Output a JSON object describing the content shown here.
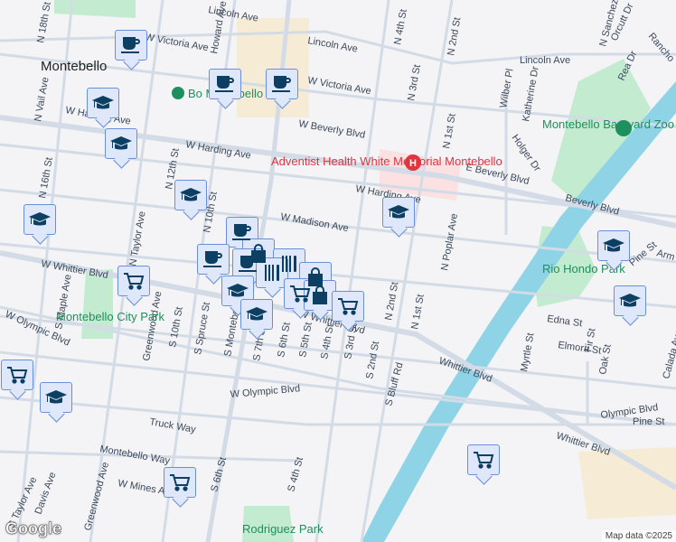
{
  "map": {
    "city_label": "Montebello",
    "streets": [
      "Lincoln Ave",
      "Lincoln Ave",
      "Lincoln Ave",
      "W Victoria Ave",
      "W Victoria Ave",
      "W Beverly Blvd",
      "E Beverly Blvd",
      "Beverly Blvd",
      "W Harding Ave",
      "W Harding Ave",
      "W Harding Ave",
      "W Madison Ave",
      "W Whittier Blvd",
      "W Whittier Blvd",
      "Whittier Blvd",
      "Whittier Blvd",
      "W Olympic Blvd",
      "W Olympic Blvd",
      "Olympic Blvd",
      "Truck Way",
      "Montebello Way",
      "W Mines Ave",
      "N 18th St",
      "N 16th St",
      "N Vail Ave",
      "N 12th St",
      "N 10th St",
      "Howard Ave",
      "N 4th St",
      "N 3rd St",
      "N 2nd St",
      "N 1st St",
      "N Poplar Ave",
      "Wilber Pl",
      "Katherine Dr",
      "Holger Dr",
      "N Sanchez",
      "Orcutt Dr",
      "Rancho",
      "Rea Dr",
      "N Taylor Ave",
      "S Maple Ave",
      "Greenwood Ave",
      "S 10th St",
      "S Spruce St",
      "S Montebello Blvd",
      "S 7th St",
      "S 6th St",
      "S 5th St",
      "S 4th St",
      "S 3rd St",
      "S 2nd St",
      "N 2nd St",
      "N 1st St",
      "S Bluff Rd",
      "Edna St",
      "Elmora St",
      "Myrtle St",
      "Oak St",
      "Fir St",
      "Pine St",
      "Pine St",
      "Calada Ave",
      "S 4th St",
      "S 6th St",
      "S Taylor Ave",
      "Davis Ave",
      "Greenwood Ave",
      "Arm"
    ],
    "pois": {
      "botanical": "Bo      Montebello",
      "hospital": "Adventist Health White Memorial Montebello",
      "zoo": "Montebello Barnyard Zoo",
      "rio_hondo": "Rio Hondo Park",
      "city_park": "Montebello City Park",
      "rodriguez": "Rodriguez Park"
    },
    "markers": [
      "coffee",
      "coffee",
      "coffee",
      "coffee",
      "coffee",
      "coffee",
      "school",
      "school",
      "school",
      "school",
      "school",
      "school",
      "school",
      "school",
      "school",
      "school",
      "cart",
      "cart",
      "cart",
      "cart",
      "cart",
      "bag",
      "bag",
      "bag",
      "restaurant",
      "restaurant"
    ],
    "attribution": "Map data ©2025",
    "logo": "Google"
  },
  "colors": {
    "marker_bg": "#dfe8fb",
    "marker_border": "#6a8fd8",
    "icon": "#0d3f63",
    "road": "#d3dce6",
    "river": "#8fd4e6",
    "park": "#c3ebd0"
  }
}
